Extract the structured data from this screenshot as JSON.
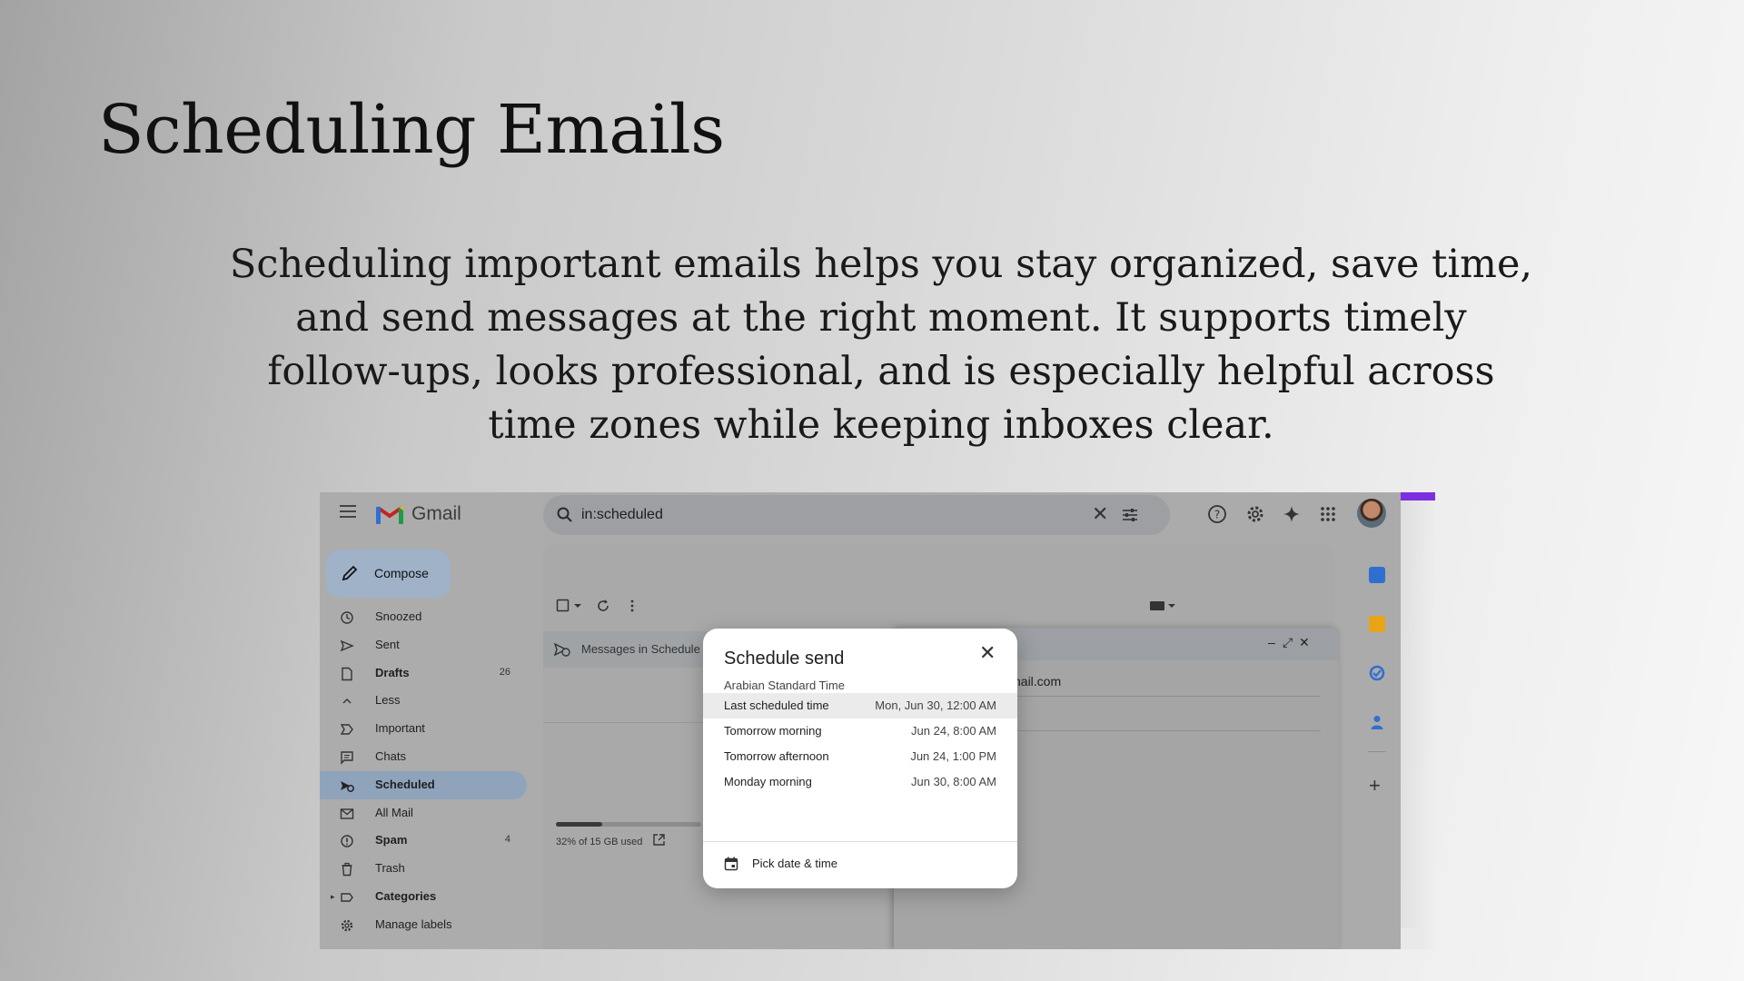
{
  "slide": {
    "title": "Scheduling Emails",
    "body": "Scheduling important emails helps you stay organized, save time, and send messages at the right moment. It supports timely follow-ups, looks professional, and is especially helpful across time zones while keeping inboxes clear."
  },
  "gmail": {
    "app_name": "Gmail",
    "search": {
      "value": "in:scheduled"
    },
    "compose_label": "Compose",
    "nav": [
      {
        "label": "Snoozed",
        "icon": "clock-icon",
        "bold": false,
        "count": ""
      },
      {
        "label": "Sent",
        "icon": "send-icon",
        "bold": false,
        "count": ""
      },
      {
        "label": "Drafts",
        "icon": "draft-icon",
        "bold": true,
        "count": "26"
      },
      {
        "label": "Less",
        "icon": "chevron-up-icon",
        "bold": false,
        "count": ""
      },
      {
        "label": "Important",
        "icon": "important-icon",
        "bold": false,
        "count": ""
      },
      {
        "label": "Chats",
        "icon": "chat-icon",
        "bold": false,
        "count": ""
      },
      {
        "label": "Scheduled",
        "icon": "scheduled-icon",
        "bold": true,
        "count": "",
        "active": true
      },
      {
        "label": "All Mail",
        "icon": "all-mail-icon",
        "bold": false,
        "count": ""
      },
      {
        "label": "Spam",
        "icon": "spam-icon",
        "bold": true,
        "count": "4"
      },
      {
        "label": "Trash",
        "icon": "trash-icon",
        "bold": false,
        "count": ""
      },
      {
        "label": "Categories",
        "icon": "label-icon",
        "bold": true,
        "count": ""
      },
      {
        "label": "Manage labels",
        "icon": "gear-icon",
        "bold": false,
        "count": ""
      }
    ],
    "messages_banner": "Messages in Schedule",
    "storage": {
      "text": "32% of 15 GB used",
      "fraction": 0.32
    },
    "compose_window": {
      "to_partial": "nail.com",
      "title_partial": "!"
    },
    "colors": {
      "accent": "#7b2fe0",
      "compose_bg": "#9fb2c8",
      "active_nav": "#8fa3bb"
    }
  },
  "dialog": {
    "title": "Schedule send",
    "timezone": "Arabian Standard Time",
    "options": [
      {
        "label": "Last scheduled time",
        "time": "Mon, Jun 30, 12:00 AM",
        "highlighted": true
      },
      {
        "label": "Tomorrow morning",
        "time": "Jun 24, 8:00 AM",
        "highlighted": false
      },
      {
        "label": "Tomorrow afternoon",
        "time": "Jun 24, 1:00 PM",
        "highlighted": false
      },
      {
        "label": "Monday morning",
        "time": "Jun 30, 8:00 AM",
        "highlighted": false
      }
    ],
    "pick_label": "Pick date & time"
  }
}
